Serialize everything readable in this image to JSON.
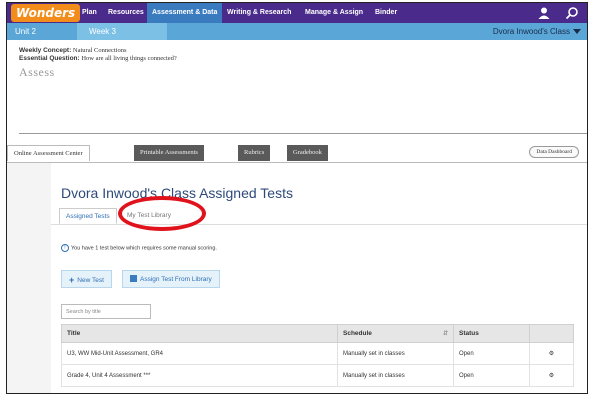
{
  "brand": {
    "logo_text": "Wonders",
    "logo_color": "#f28c1b",
    "nav_bg": "#4a2a8a"
  },
  "topnav": {
    "items": [
      {
        "label": "Plan"
      },
      {
        "label": "Resources"
      },
      {
        "label": "Assessment & Data",
        "active": true
      },
      {
        "label": "Writing & Research"
      },
      {
        "label": "Manage & Assign"
      },
      {
        "label": "Binder"
      }
    ],
    "icons": [
      "user-icon",
      "search-icon"
    ]
  },
  "unitbar": {
    "unit": "Unit 2",
    "week": "Week 3",
    "class_selected": "Dvora Inwood's Class"
  },
  "concept": {
    "weekly_label": "Weekly Concept:",
    "weekly_value": "Natural Connections",
    "question_label": "Essential Question:",
    "question_value": "How are all living things connected?"
  },
  "section_title": "Assess",
  "tabs": [
    {
      "label": "Online Assessment Center",
      "active": true
    },
    {
      "label": "Printable Assessments"
    },
    {
      "label": "Rubrics"
    },
    {
      "label": "Gradebook"
    }
  ],
  "data_dashboard": "Data Dashboard",
  "main": {
    "title": "Dvora Inwood's Class Assigned Tests",
    "subtabs": [
      {
        "label": "Assigned Tests",
        "active": true
      },
      {
        "label": "My Test Library"
      }
    ],
    "notice": "You have 1 test below which requires some manual scoring.",
    "buttons": {
      "new_test": "New Test",
      "assign_from_library": "Assign Test From Library"
    },
    "search_placeholder": "Search by title",
    "table": {
      "headers": [
        "Title",
        "Schedule",
        "Status"
      ],
      "rows": [
        {
          "title": "U3, WW Mid-Unit Assessment, GR4",
          "schedule": "Manually set in classes",
          "status": "Open"
        },
        {
          "title": "Grade 4, Unit 4 Assessment ***",
          "schedule": "Manually set in classes",
          "status": "Open"
        }
      ]
    }
  },
  "annotation_color": "#e0131c"
}
